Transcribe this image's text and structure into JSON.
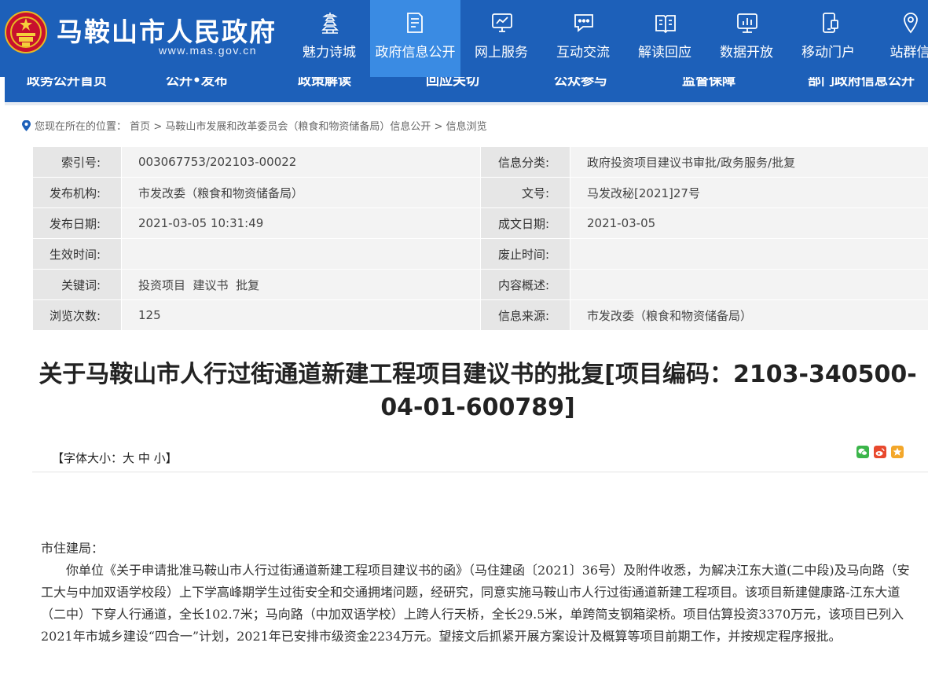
{
  "header": {
    "site_title": "马鞍山市人民政府",
    "site_url": "www.mas.gov.cn",
    "nav": [
      {
        "label": "魅力诗城",
        "icon": "pagoda-icon"
      },
      {
        "label": "政府信息公开",
        "icon": "document-icon"
      },
      {
        "label": "网上服务",
        "icon": "monitor-icon"
      },
      {
        "label": "互动交流",
        "icon": "chat-icon"
      },
      {
        "label": "解读回应",
        "icon": "book-icon"
      },
      {
        "label": "数据开放",
        "icon": "chart-icon"
      },
      {
        "label": "移动门户",
        "icon": "mobile-icon"
      },
      {
        "label": "站群信",
        "icon": "location-icon"
      }
    ],
    "colors": {
      "primary": "#1d60b9",
      "active": "#3a8be3"
    }
  },
  "subnav": {
    "items": [
      "政务公开首页",
      "公开•发布",
      "政策解读",
      "回应关切",
      "公众参与",
      "监督保障",
      "部门政府信息公开"
    ]
  },
  "breadcrumb": {
    "prefix": "您现在所在的位置：",
    "items": [
      "首页",
      "马鞍山市发展和改革委员会（粮食和物资储备局）信息公开",
      "信息浏览"
    ],
    "separator": ">"
  },
  "meta": {
    "rows": [
      {
        "l1": "索引号:",
        "v1": "003067753/202103-00022",
        "l2": "信息分类:",
        "v2": "政府投资项目建议书审批/政务服务/批复"
      },
      {
        "l1": "发布机构:",
        "v1": "市发改委（粮食和物资储备局）",
        "l2": "文号:",
        "v2": "马发改秘[2021]27号"
      },
      {
        "l1": "发布日期:",
        "v1": "2021-03-05 10:31:49",
        "l2": "成文日期:",
        "v2": "2021-03-05"
      },
      {
        "l1": "生效时间:",
        "v1": "",
        "l2": "废止时间:",
        "v2": ""
      },
      {
        "l1": "关键词:",
        "v1": "投资项目  建议书  批复",
        "l2": "内容概述:",
        "v2": ""
      },
      {
        "l1": "浏览次数:",
        "v1": "125",
        "l2": "信息来源:",
        "v2": "市发改委（粮食和物资储备局）"
      }
    ]
  },
  "article": {
    "title_line1": "关于马鞍山市人行过街通道新建工程项目建议书的批复[项目编码：2103-340500-",
    "title_line2": "04-01-600789]",
    "fontsize_prefix": "【字体大小：",
    "fontsize_large": "大",
    "fontsize_medium": "中",
    "fontsize_small": "小",
    "fontsize_suffix": "】",
    "share": [
      {
        "icon": "wechat-icon",
        "color": "#3bb54a"
      },
      {
        "icon": "weibo-icon",
        "color": "#e8492e"
      },
      {
        "icon": "qzone-icon",
        "color": "#f3a72a"
      }
    ],
    "salutation": "市住建局：",
    "paragraph": "你单位《关于申请批准马鞍山市人行过街通道新建工程项目建议书的函》（马住建函〔2021〕36号）及附件收悉，为解决江东大道(二中段)及马向路（安工大与中加双语学校段）上下学高峰期学生过街安全和交通拥堵问题，经研究，同意实施马鞍山市人行过街通道新建工程项目。该项目新建健康路-江东大道（二中）下穿人行通道，全长102.7米；马向路（中加双语学校）上跨人行天桥，全长29.5米，单跨简支钢箱梁桥。项目估算投资3370万元，该项目已列入2021年市城乡建设“四合一”计划，2021年已安排市级资金2234万元。望接文后抓紧开展方案设计及概算等项目前期工作，并按规定程序报批。"
  }
}
